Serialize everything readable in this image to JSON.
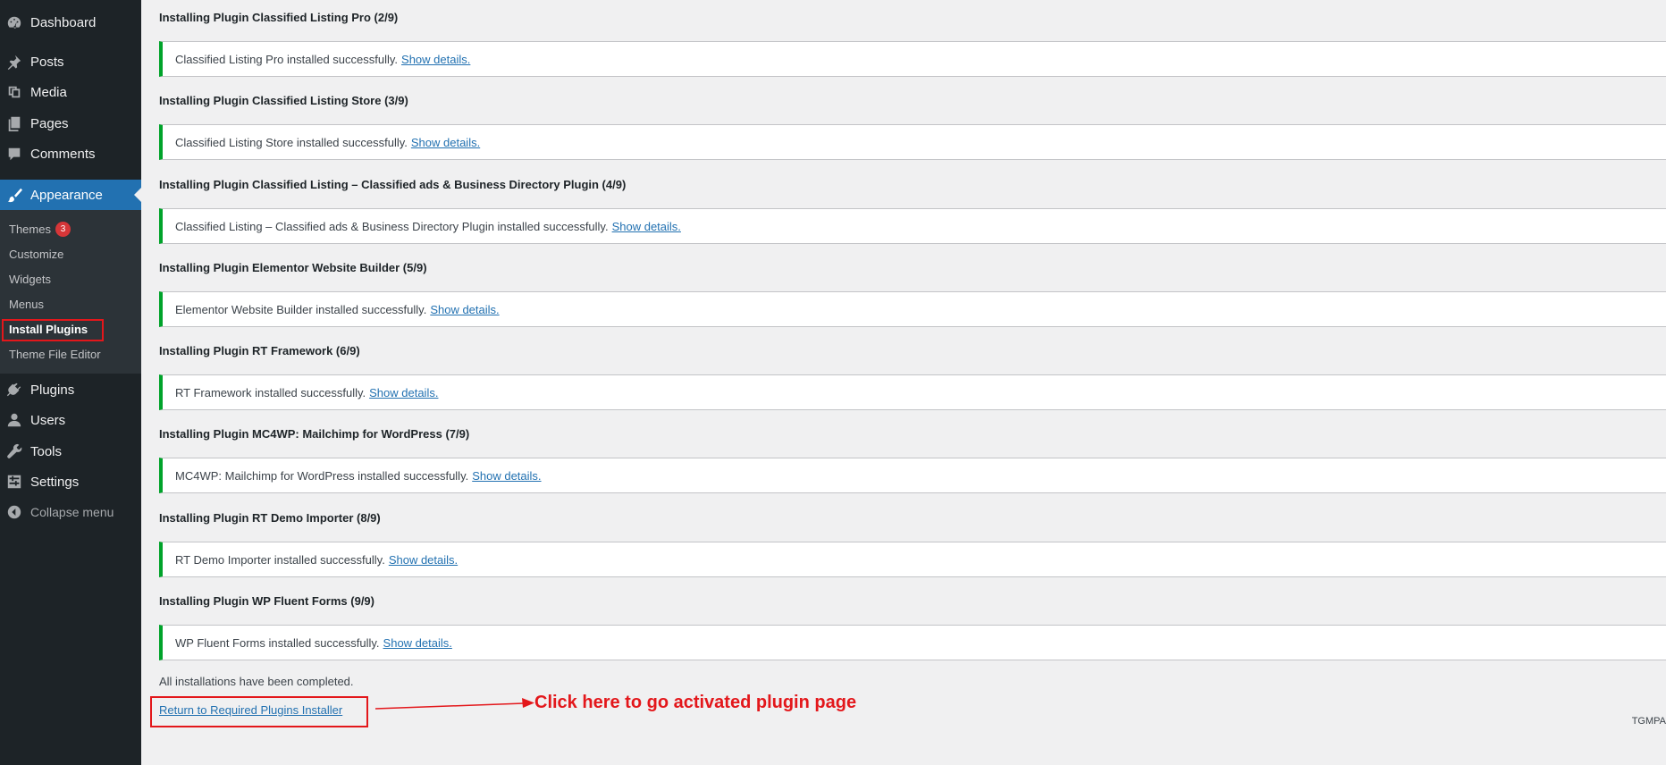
{
  "sidebar": {
    "items": [
      {
        "label": "Dashboard",
        "icon": "dashboard-icon"
      },
      {
        "label": "Posts",
        "icon": "pin-icon"
      },
      {
        "label": "Media",
        "icon": "media-icon"
      },
      {
        "label": "Pages",
        "icon": "pages-icon"
      },
      {
        "label": "Comments",
        "icon": "comment-icon"
      },
      {
        "label": "Appearance",
        "icon": "brush-icon",
        "active": true
      },
      {
        "label": "Plugins",
        "icon": "plugin-icon"
      },
      {
        "label": "Users",
        "icon": "user-icon"
      },
      {
        "label": "Tools",
        "icon": "wrench-icon"
      },
      {
        "label": "Settings",
        "icon": "settings-icon"
      },
      {
        "label": "Collapse menu",
        "icon": "collapse-icon"
      }
    ],
    "submenu": [
      {
        "label": "Themes",
        "badge": "3"
      },
      {
        "label": "Customize"
      },
      {
        "label": "Widgets"
      },
      {
        "label": "Menus"
      },
      {
        "label": "Install Plugins",
        "current": true
      },
      {
        "label": "Theme File Editor"
      }
    ]
  },
  "main": {
    "steps": [
      {
        "title": "Installing Plugin Classified Listing Pro (2/9)",
        "message": "Classified Listing Pro installed successfully.",
        "link": "Show details."
      },
      {
        "title": "Installing Plugin Classified Listing Store (3/9)",
        "message": "Classified Listing Store installed successfully.",
        "link": "Show details."
      },
      {
        "title": "Installing Plugin Classified Listing – Classified ads & Business Directory Plugin (4/9)",
        "message": "Classified Listing – Classified ads & Business Directory Plugin installed successfully.",
        "link": "Show details."
      },
      {
        "title": "Installing Plugin Elementor Website Builder (5/9)",
        "message": "Elementor Website Builder installed successfully.",
        "link": "Show details."
      },
      {
        "title": "Installing Plugin RT Framework (6/9)",
        "message": "RT Framework installed successfully.",
        "link": "Show details."
      },
      {
        "title": "Installing Plugin MC4WP: Mailchimp for WordPress (7/9)",
        "message": "MC4WP: Mailchimp for WordPress installed successfully.",
        "link": "Show details."
      },
      {
        "title": "Installing Plugin RT Demo Importer (8/9)",
        "message": "RT Demo Importer installed successfully.",
        "link": "Show details."
      },
      {
        "title": "Installing Plugin WP Fluent Forms (9/9)",
        "message": "WP Fluent Forms installed successfully.",
        "link": "Show details."
      }
    ],
    "complete_text": "All installations have been completed.",
    "return_link": "Return to Required Plugins Installer",
    "annotation": "Click here to go activated plugin page",
    "footer": "TGMPA"
  },
  "colors": {
    "sidebar_bg": "#1d2327",
    "active_blue": "#2271b1",
    "success_green": "#00a32a",
    "annotation_red": "#e3171b"
  }
}
